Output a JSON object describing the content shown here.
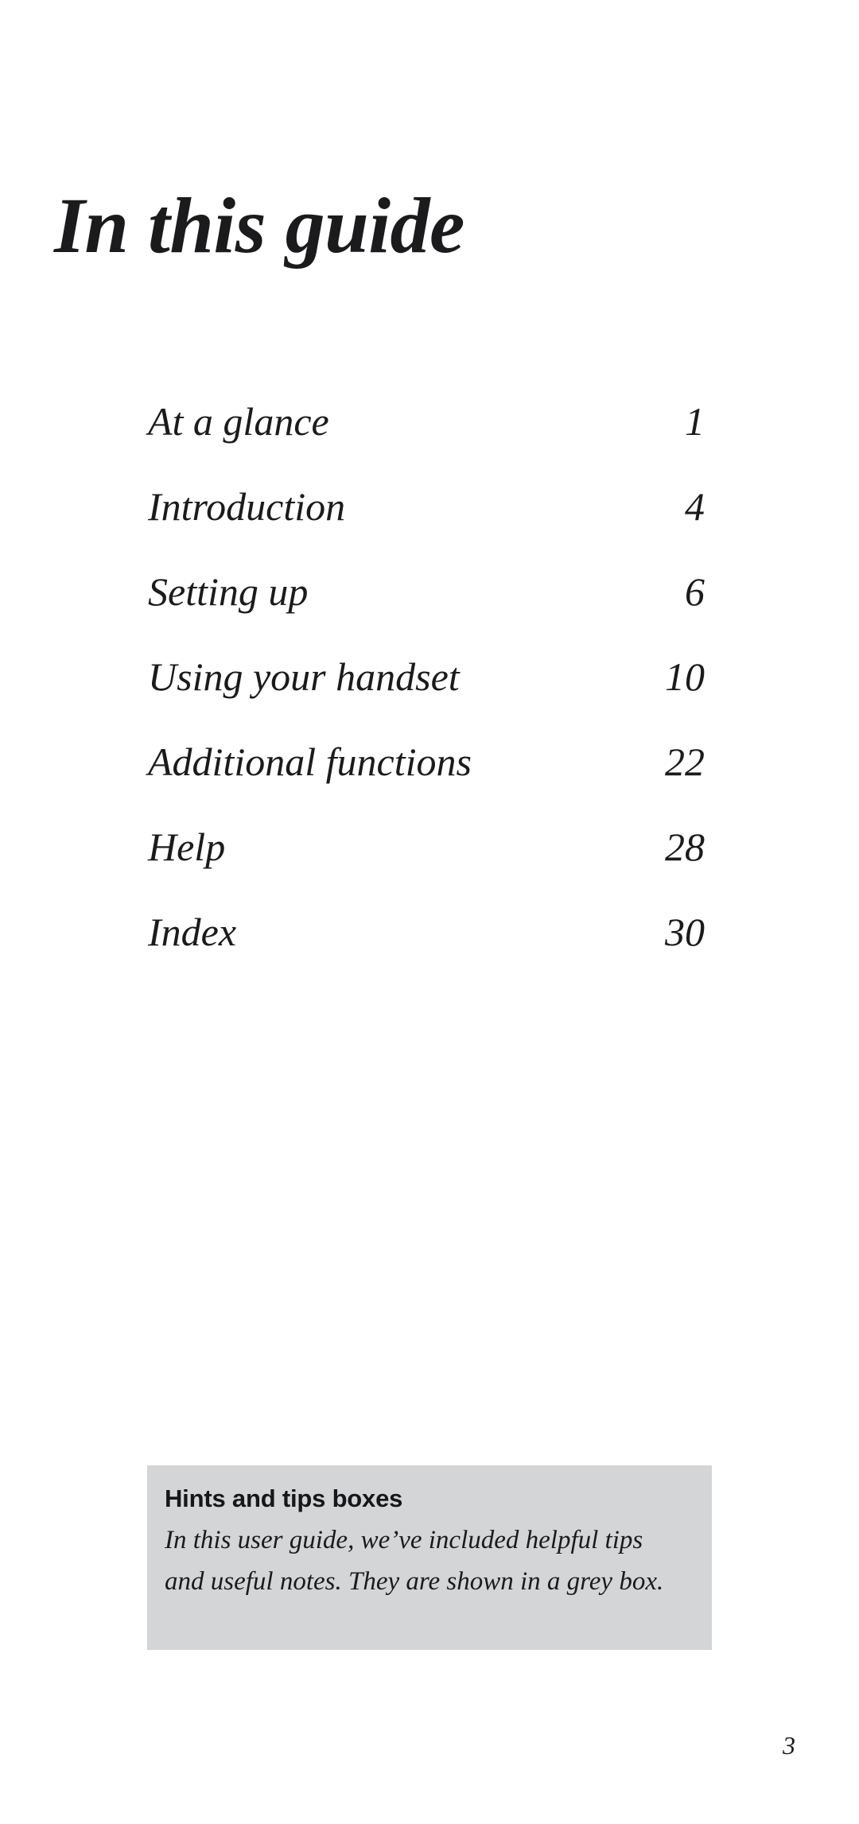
{
  "page": {
    "title": "In this guide",
    "folio": "3",
    "background_color": "#ffffff",
    "text_color": "#1b1b1d"
  },
  "toc": {
    "entries": [
      {
        "label": "At a glance",
        "page": "1"
      },
      {
        "label": "Introduction",
        "page": "4"
      },
      {
        "label": "Setting up",
        "page": "6"
      },
      {
        "label": "Using your handset",
        "page": "10"
      },
      {
        "label": "Additional functions",
        "page": "22"
      },
      {
        "label": "Help",
        "page": "28"
      },
      {
        "label": "Index",
        "page": "30"
      }
    ]
  },
  "hints_box": {
    "heading": "Hints and tips boxes",
    "body": "In this user guide, we’ve included helpful tips and useful notes. They are shown in a grey box.",
    "background_color": "#d4d5d6"
  }
}
